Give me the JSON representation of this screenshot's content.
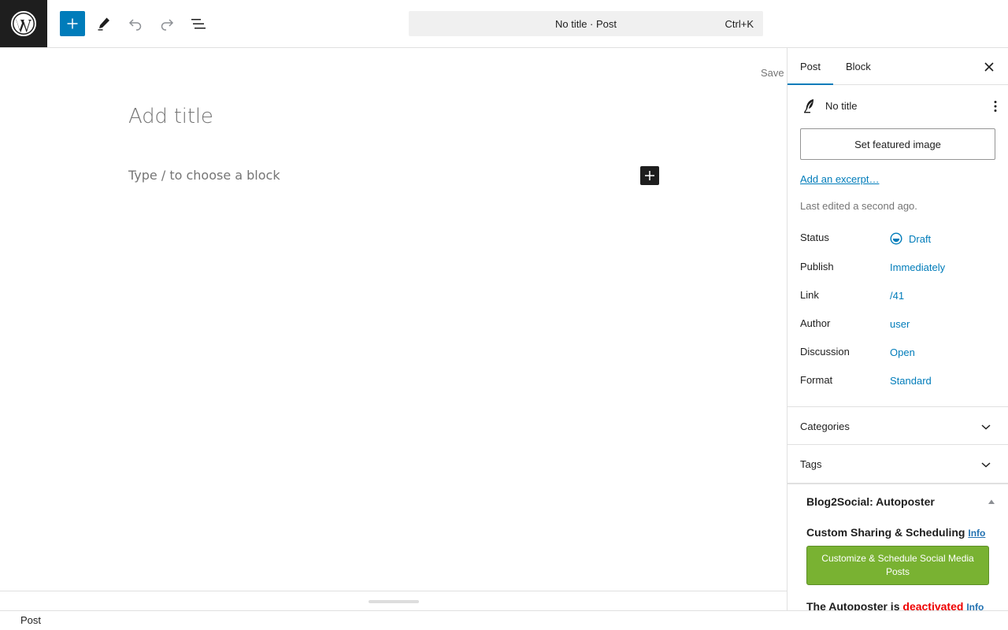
{
  "header": {
    "command_bar": {
      "title": "No title · Post",
      "shortcut": "Ctrl+K"
    },
    "icons": {
      "logo": "wordpress-logo",
      "add": "plus-icon",
      "tools": "pencil-icon",
      "undo": "undo-icon",
      "redo": "redo-icon",
      "document_overview": "list-view-icon"
    }
  },
  "editor": {
    "save_label": "Save",
    "title_placeholder": "Add title",
    "block_placeholder": "Type / to choose a block"
  },
  "footer": {
    "breadcrumb": "Post"
  },
  "sidebar": {
    "tabs": [
      {
        "label": "Post",
        "active": true
      },
      {
        "label": "Block",
        "active": false
      }
    ],
    "post_card": {
      "title": "No title"
    },
    "featured_image_label": "Set featured image",
    "excerpt_link": "Add an excerpt…",
    "last_edited": "Last edited a second ago.",
    "meta": [
      {
        "label": "Status",
        "value": "Draft"
      },
      {
        "label": "Publish",
        "value": "Immediately"
      },
      {
        "label": "Link",
        "value": "/41"
      },
      {
        "label": "Author",
        "value": "user"
      },
      {
        "label": "Discussion",
        "value": "Open"
      },
      {
        "label": "Format",
        "value": "Standard"
      }
    ],
    "panels": [
      {
        "title": "Categories"
      },
      {
        "title": "Tags"
      }
    ],
    "blog2social": {
      "title": "Blog2Social: Autoposter",
      "custom_title": "Custom Sharing & Scheduling",
      "info_label": "Info",
      "button_label": "Customize & Schedule Social Media Posts",
      "autoposter_prefix": "The Autoposter is",
      "autoposter_state": "deactivated",
      "info_label_2": "Info"
    }
  },
  "colors": {
    "accent": "#007cba",
    "dark": "#1e1e1e",
    "b2s_green": "#79b232",
    "deactivated_red": "#e00000"
  }
}
